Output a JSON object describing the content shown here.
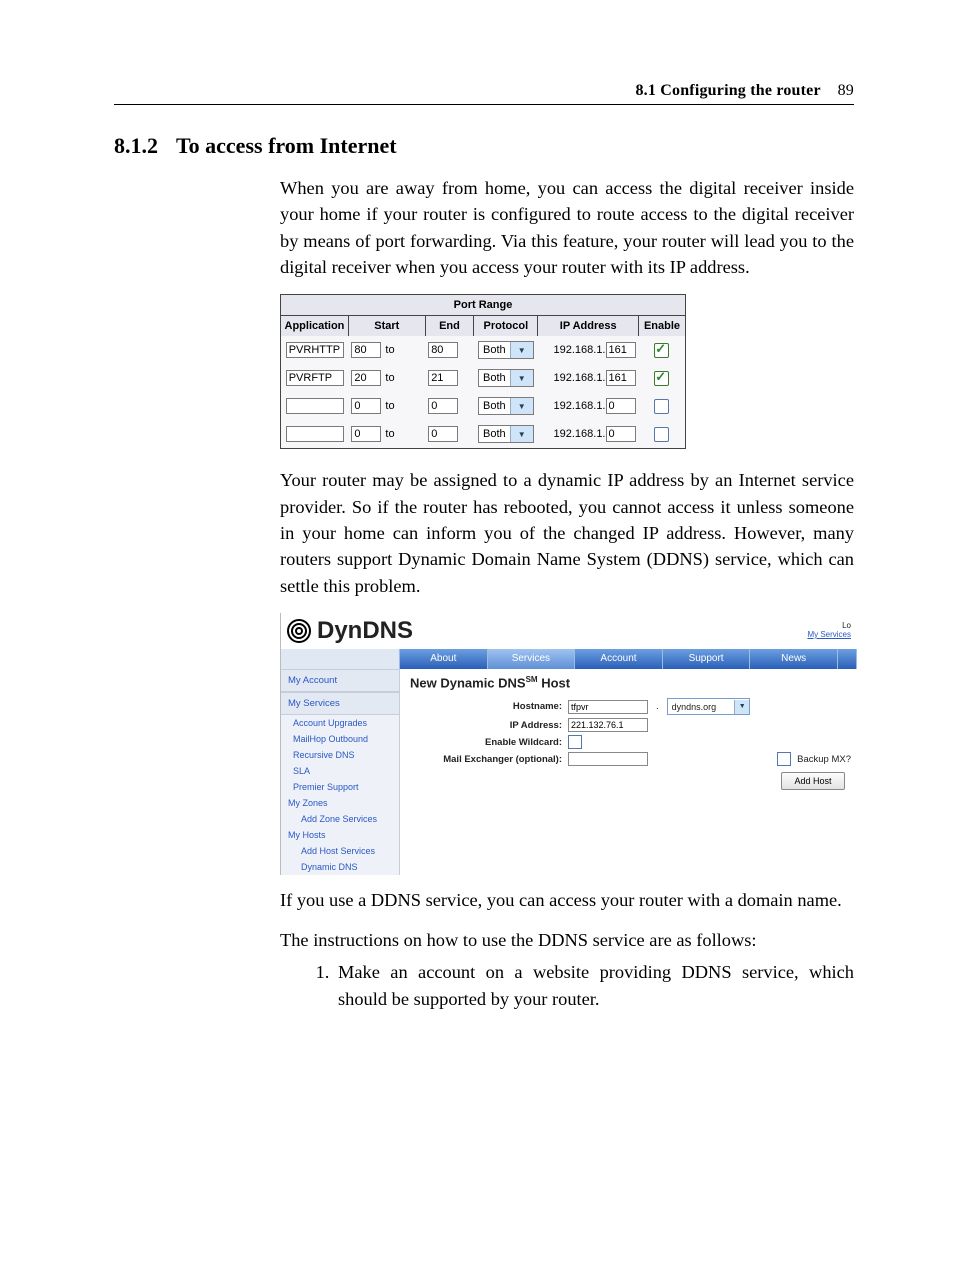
{
  "header": {
    "section_ref": "8.1 Configuring the router",
    "page_number": "89"
  },
  "section": {
    "number": "8.1.2",
    "title": "To access from Internet"
  },
  "para1": "When you are away from home, you can access the digital receiver inside your home if your router is configured to route access to the digital receiver by means of port forwarding. Via this feature, your router will lead you to the digital receiver when you access your router with its IP address.",
  "port_table": {
    "title": "Port Range",
    "headers": {
      "application": "Application",
      "start": "Start",
      "end": "End",
      "protocol": "Protocol",
      "ip": "IP Address",
      "enable": "Enable"
    },
    "rows": [
      {
        "app": "PVRHTTP",
        "start": "80",
        "to_label": "to",
        "end": "80",
        "proto": "Both",
        "ip_prefix": "192.168.1.",
        "ip_last": "161",
        "enabled": true
      },
      {
        "app": "PVRFTP",
        "start": "20",
        "to_label": "to",
        "end": "21",
        "proto": "Both",
        "ip_prefix": "192.168.1.",
        "ip_last": "161",
        "enabled": true
      },
      {
        "app": "",
        "start": "0",
        "to_label": "to",
        "end": "0",
        "proto": "Both",
        "ip_prefix": "192.168.1.",
        "ip_last": "0",
        "enabled": false
      },
      {
        "app": "",
        "start": "0",
        "to_label": "to",
        "end": "0",
        "proto": "Both",
        "ip_prefix": "192.168.1.",
        "ip_last": "0",
        "enabled": false
      }
    ]
  },
  "para2": "Your router may be assigned to a dynamic IP address by an Internet service provider. So if the router has rebooted, you cannot access it unless someone in your home can inform you of the changed IP address. However, many routers support Dynamic Domain Name System (DDNS) service, which can settle this problem.",
  "dyndns": {
    "logo_text": "DynDNS",
    "top_links": {
      "l1": "Lo",
      "l2": "My Services"
    },
    "nav": [
      "About",
      "Services",
      "Account",
      "Support",
      "News"
    ],
    "sidebar": {
      "h1": "My Account",
      "h2": "My Services",
      "items_a": [
        "Account Upgrades",
        "MailHop Outbound",
        "Recursive DNS",
        "SLA",
        "Premier Support"
      ],
      "h3": "My Zones",
      "items_b": [
        "Add Zone Services"
      ],
      "h4": "My Hosts",
      "items_c": [
        "Add Host Services",
        "Dynamic DNS"
      ]
    },
    "main": {
      "title_a": "New Dynamic DNS",
      "title_b": "SM",
      "title_c": " Host",
      "rows": {
        "hostname_lbl": "Hostname:",
        "hostname_val": "tfpvr",
        "hostname_domain": "dyndns.org",
        "ip_lbl": "IP Address:",
        "ip_val": "221.132.76.1",
        "wildcard_lbl": "Enable Wildcard:",
        "mx_lbl": "Mail Exchanger (optional):",
        "backup_mx_lbl": "Backup MX?"
      },
      "button": "Add Host"
    }
  },
  "para3": "If you use a DDNS service, you can access your router with a domain name.",
  "para4": "The instructions on how to use the DDNS service are as follows:",
  "steps": [
    "Make an account on a website providing DDNS service, which should be supported by your router."
  ]
}
